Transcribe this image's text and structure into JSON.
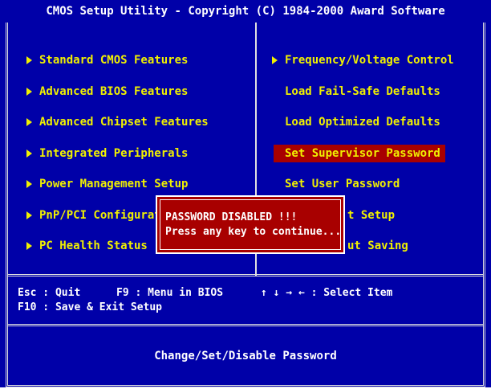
{
  "title": "CMOS Setup Utility - Copyright (C) 1984-2000 Award Software",
  "menu": {
    "left": [
      {
        "label": "Standard CMOS Features",
        "arrow": true
      },
      {
        "label": "Advanced BIOS Features",
        "arrow": true
      },
      {
        "label": "Advanced Chipset Features",
        "arrow": true
      },
      {
        "label": "Integrated Peripherals",
        "arrow": true
      },
      {
        "label": "Power Management Setup",
        "arrow": true
      },
      {
        "label": "PnP/PCI Configurati",
        "arrow": true
      },
      {
        "label": "PC Health Status",
        "arrow": true
      }
    ],
    "right": [
      {
        "label": "Frequency/Voltage Control",
        "arrow": true
      },
      {
        "label": "Load Fail-Safe Defaults",
        "arrow": false
      },
      {
        "label": "Load Optimized Defaults",
        "arrow": false
      },
      {
        "label": "Set Supervisor Password",
        "arrow": false,
        "selected": true
      },
      {
        "label": "Set User Password",
        "arrow": false
      },
      {
        "label": "t Setup",
        "arrow": false
      },
      {
        "label": "ut Saving",
        "arrow": false
      }
    ]
  },
  "help": {
    "esc": "Esc : Quit",
    "f9": "F9 : Menu in BIOS",
    "arrows": "↑ ↓ → ←   : Select Item",
    "f10": "F10 : Save & Exit Setup"
  },
  "status_text": "Change/Set/Disable Password",
  "dialog": {
    "line1": "PASSWORD DISABLED !!!",
    "line2": "Press any key to continue..."
  },
  "colors": {
    "background": "#0000a8",
    "menu_text": "#f0f000",
    "highlight": "#a80000",
    "text": "#ffffff"
  }
}
